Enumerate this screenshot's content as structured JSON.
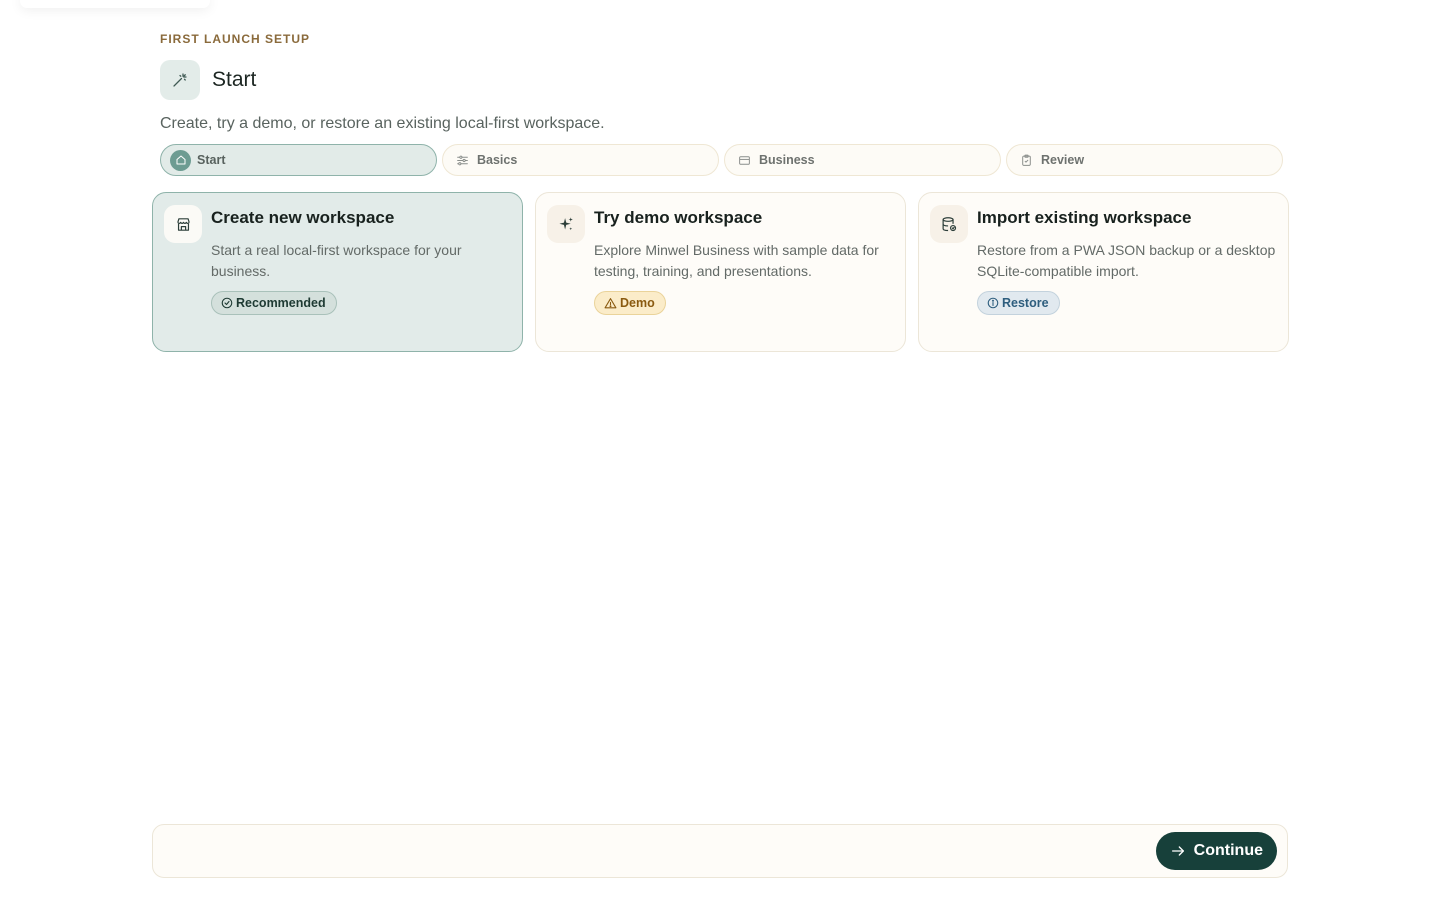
{
  "header": {
    "eyebrow": "FIRST LAUNCH SETUP",
    "title": "Start",
    "title_icon": "magic-wand-icon",
    "subtitle": "Create, try a demo, or restore an existing local-first workspace."
  },
  "steps": [
    {
      "label": "Start",
      "icon": "home-icon",
      "active": true
    },
    {
      "label": "Basics",
      "icon": "sliders-icon",
      "active": false
    },
    {
      "label": "Business",
      "icon": "store-icon",
      "active": false
    },
    {
      "label": "Review",
      "icon": "clipboard-check-icon",
      "active": false
    }
  ],
  "options": [
    {
      "title": "Create new workspace",
      "description": "Start a real local-first workspace for your business.",
      "icon": "storefront-icon",
      "badge": "Recommended",
      "badge_icon": "check-circle-icon",
      "selected": true
    },
    {
      "title": "Try demo workspace",
      "description": "Explore Minwel Business with sample data for testing, training, and presentations.",
      "icon": "sparkles-icon",
      "badge": "Demo",
      "badge_icon": "warning-icon",
      "selected": false
    },
    {
      "title": "Import existing workspace",
      "description": "Restore from a PWA JSON backup or a desktop SQLite-compatible import.",
      "icon": "database-icon",
      "badge": "Restore",
      "badge_icon": "info-icon",
      "selected": false
    }
  ],
  "footer": {
    "continue_label": "Continue",
    "continue_icon": "arrow-right-icon"
  },
  "colors": {
    "accent": "#17403a",
    "selected_bg": "#e2ebe9",
    "eyebrow": "#8a6a3b"
  }
}
